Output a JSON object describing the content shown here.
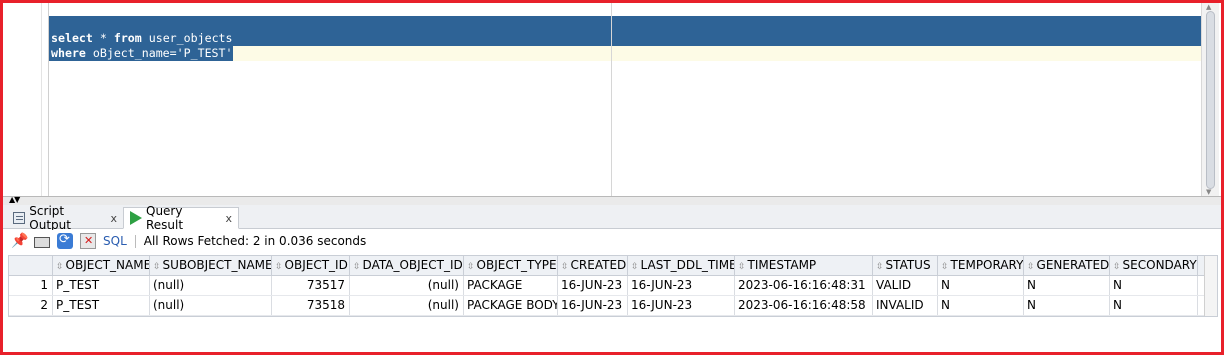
{
  "editor": {
    "line1": {
      "kw1": "select",
      "rest1": " * ",
      "kw2": "from",
      "rest2": " user_objects"
    },
    "line2": {
      "kw1": "where",
      "rest1": " oBject_name='P_TEST'"
    }
  },
  "tabs": [
    {
      "label": "Script Output",
      "close": "x",
      "icon": "script-output-icon"
    },
    {
      "label": "Query Result",
      "close": "x",
      "icon": "run-play-icon"
    }
  ],
  "toolbar": {
    "sql_label": "SQL",
    "status": "All Rows Fetched: 2 in 0.036 seconds"
  },
  "grid": {
    "columns": [
      "OBJECT_NAME",
      "SUBOBJECT_NAME",
      "OBJECT_ID",
      "DATA_OBJECT_ID",
      "OBJECT_TYPE",
      "CREATED",
      "LAST_DDL_TIME",
      "TIMESTAMP",
      "STATUS",
      "TEMPORARY",
      "GENERATED",
      "SECONDARY"
    ],
    "rows": [
      {
        "num": "1",
        "cells": [
          "P_TEST",
          "(null)",
          "73517",
          "(null)",
          "PACKAGE",
          "16-JUN-23",
          "16-JUN-23",
          "2023-06-16:16:48:31",
          "VALID",
          "N",
          "N",
          "N"
        ]
      },
      {
        "num": "2",
        "cells": [
          "P_TEST",
          "(null)",
          "73518",
          "(null)",
          "PACKAGE BODY",
          "16-JUN-23",
          "16-JUN-23",
          "2023-06-16:16:48:58",
          "INVALID",
          "N",
          "N",
          "N"
        ]
      }
    ]
  },
  "colors": {
    "selection": "#2e6396",
    "frame": "#e8202a",
    "link": "#2a5db0"
  }
}
